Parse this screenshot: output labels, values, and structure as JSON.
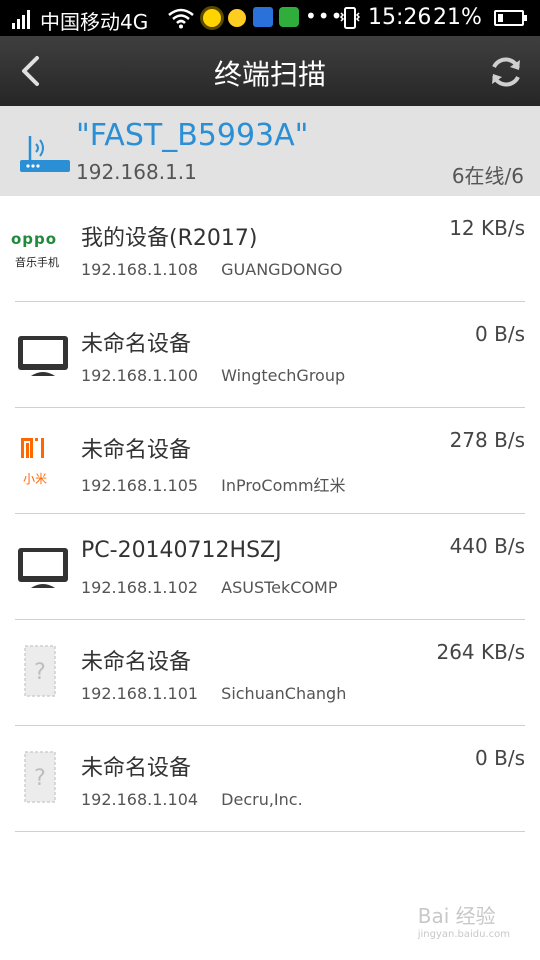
{
  "status_bar": {
    "carrier": "中国移动4G",
    "time": "15:26",
    "battery_percent": "21%",
    "battery_level": 0.21
  },
  "header": {
    "title": "终端扫描"
  },
  "router": {
    "name": "\"FAST_B5993A\"",
    "ip": "192.168.1.1",
    "online_count": "6在线/6"
  },
  "devices": [
    {
      "name": "我的设备(R2017)",
      "ip": "192.168.1.108",
      "vendor": "GUANGDONGO",
      "speed": "12 KB/s",
      "icon": "oppo-logo-icon",
      "logo_text": "oppo",
      "logo_sub": "音乐手机"
    },
    {
      "name": "未命名设备",
      "ip": "192.168.1.100",
      "vendor": "WingtechGroup",
      "speed": "0 B/s",
      "icon": "monitor-icon"
    },
    {
      "name": "未命名设备",
      "ip": "192.168.1.105",
      "vendor": "InProComm红米",
      "speed": "278 B/s",
      "icon": "xiaomi-logo-icon",
      "logo_text": "MI",
      "logo_sub": "小米"
    },
    {
      "name": "PC-20140712HSZJ",
      "ip": "192.168.1.102",
      "vendor": "ASUSTekCOMP",
      "speed": "440 B/s",
      "icon": "monitor-icon"
    },
    {
      "name": "未命名设备",
      "ip": "192.168.1.101",
      "vendor": "SichuanChangh",
      "speed": "264 KB/s",
      "icon": "unknown-device-icon"
    },
    {
      "name": "未命名设备",
      "ip": "192.168.1.104",
      "vendor": "Decru,Inc.",
      "speed": "0 B/s",
      "icon": "unknown-device-icon"
    }
  ],
  "watermark": {
    "text": "Bai 经验",
    "sub": "jingyan.baidu.com"
  },
  "colors": {
    "accent": "#2b8fd6",
    "header": "#2f2f2f",
    "router_bg": "#e2e2e2",
    "xiaomi": "#ff6700",
    "oppo": "#1f8a3a"
  }
}
